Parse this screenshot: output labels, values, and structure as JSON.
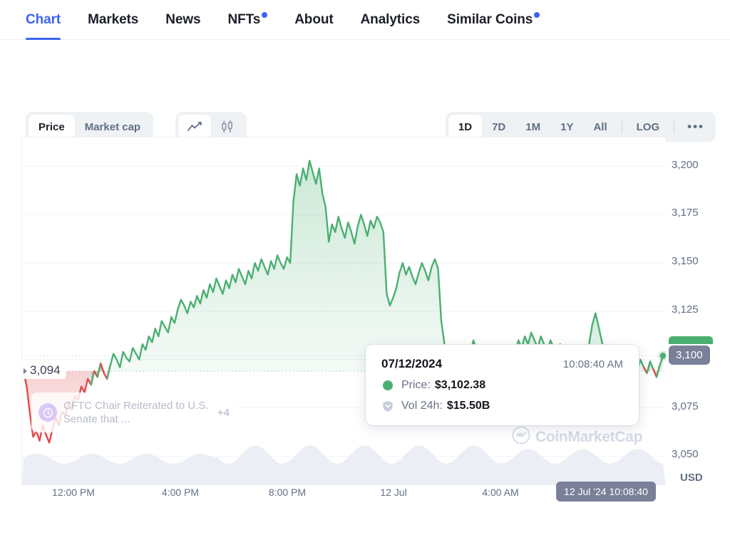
{
  "tabs": [
    {
      "label": "Chart",
      "active": true,
      "badge": false
    },
    {
      "label": "Markets",
      "active": false,
      "badge": false
    },
    {
      "label": "News",
      "active": false,
      "badge": false
    },
    {
      "label": "NFTs",
      "active": false,
      "badge": true
    },
    {
      "label": "About",
      "active": false,
      "badge": false
    },
    {
      "label": "Analytics",
      "active": false,
      "badge": false
    },
    {
      "label": "Similar Coins",
      "active": false,
      "badge": true
    }
  ],
  "controls": {
    "metric": {
      "options": [
        "Price",
        "Market cap"
      ],
      "selected": "Price"
    },
    "style": {
      "options": [
        "line-chart-icon",
        "candlestick-chart-icon"
      ],
      "selected": "line-chart-icon"
    },
    "range": {
      "options": [
        "1D",
        "7D",
        "1M",
        "1Y",
        "All"
      ],
      "selected": "1D"
    },
    "log_label": "LOG",
    "more_label": "•••"
  },
  "chart_data": {
    "type": "area",
    "title": "",
    "xlabel": "",
    "ylabel": "USD",
    "currency": "USD",
    "ylim": [
      3035,
      3215
    ],
    "yticks": [
      3200,
      3175,
      3150,
      3125,
      3100,
      3075,
      3050
    ],
    "ytick_labels": [
      "3,200",
      "3,175",
      "3,150",
      "3,125",
      "3,100",
      "3,075",
      "3,050"
    ],
    "xticks": [
      "12:00 PM",
      "4:00 PM",
      "8:00 PM",
      "12 Jul",
      "4:00 AM"
    ],
    "grid": true,
    "current_price_label": "3,100",
    "open_reference_label": "3,094",
    "cursor_x_label": "12 Jul '24 10:08:40",
    "colors": {
      "up": "#4caf72",
      "down": "#e04b50",
      "badge": "#7b8099",
      "accent": "#3d62f4"
    },
    "series": [
      {
        "name": "Price",
        "unit": "USD",
        "values": [
          3094,
          3086,
          3072,
          3060,
          3063,
          3058,
          3066,
          3061,
          3057,
          3064,
          3070,
          3066,
          3073,
          3071,
          3078,
          3074,
          3081,
          3079,
          3086,
          3083,
          3090,
          3087,
          3094,
          3091,
          3098,
          3093,
          3090,
          3097,
          3103,
          3100,
          3096,
          3104,
          3101,
          3099,
          3106,
          3103,
          3100,
          3108,
          3105,
          3112,
          3109,
          3116,
          3112,
          3120,
          3117,
          3114,
          3122,
          3119,
          3126,
          3131,
          3128,
          3124,
          3130,
          3127,
          3133,
          3129,
          3136,
          3132,
          3139,
          3135,
          3142,
          3138,
          3134,
          3141,
          3137,
          3144,
          3140,
          3147,
          3143,
          3139,
          3146,
          3142,
          3150,
          3146,
          3152,
          3148,
          3144,
          3151,
          3147,
          3154,
          3150,
          3147,
          3153,
          3150,
          3182,
          3196,
          3190,
          3199,
          3193,
          3203,
          3197,
          3191,
          3199,
          3186,
          3179,
          3161,
          3170,
          3166,
          3174,
          3168,
          3163,
          3171,
          3166,
          3160,
          3169,
          3175,
          3170,
          3164,
          3172,
          3168,
          3174,
          3171,
          3166,
          3134,
          3128,
          3132,
          3137,
          3145,
          3150,
          3144,
          3148,
          3143,
          3139,
          3145,
          3150,
          3146,
          3141,
          3148,
          3152,
          3147,
          3120,
          3108,
          3101,
          3096,
          3085,
          3078,
          3091,
          3084,
          3096,
          3103,
          3110,
          3105,
          3098,
          3092,
          3100,
          3094,
          3088,
          3096,
          3091,
          3099,
          3105,
          3101,
          3096,
          3104,
          3110,
          3106,
          3112,
          3108,
          3114,
          3110,
          3106,
          3112,
          3108,
          3104,
          3110,
          3106,
          3102,
          3108,
          3104,
          3100,
          3106,
          3102,
          3105,
          3101,
          3098,
          3104,
          3108,
          3118,
          3124,
          3117,
          3109,
          3104,
          3100,
          3105,
          3101,
          3097,
          3103,
          3099,
          3095,
          3101,
          3097,
          3094,
          3100,
          3096,
          3093,
          3099,
          3095,
          3091,
          3097,
          3102
        ]
      }
    ],
    "volume_series": {
      "name": "Vol 24h",
      "note": "light shaded volume band along chart bottom"
    }
  },
  "tooltip": {
    "date": "07/12/2024",
    "time": "10:08:40 AM",
    "rows": [
      {
        "marker": "price-dot",
        "label": "Price:",
        "value": "$3,102.38"
      },
      {
        "marker": "volume-shield",
        "label": "Vol 24h:",
        "value": "$15.50B"
      }
    ]
  },
  "news_annotation": {
    "icon": "clock-icon",
    "text": "CFTC Chair Reiterated to U.S. Senate that ...",
    "more_count": "+4"
  },
  "watermark": {
    "text": "CoinMarketCap",
    "icon": "coinmarketcap-logo-icon"
  }
}
